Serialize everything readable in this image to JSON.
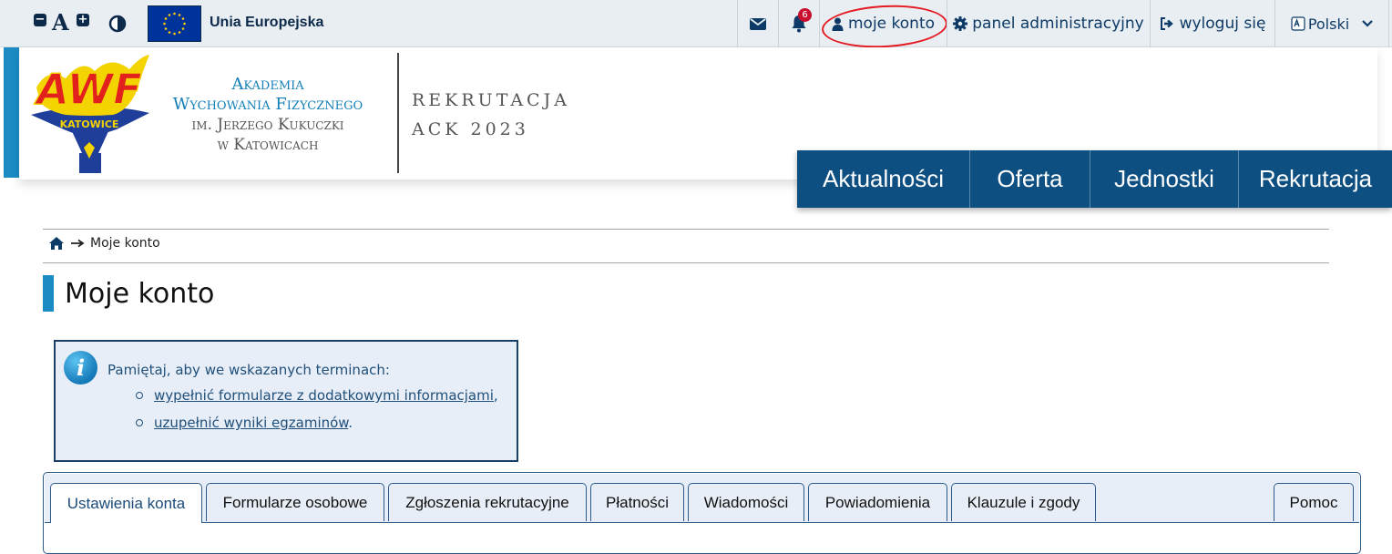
{
  "topbar": {
    "a11y": {
      "decrease": "−",
      "font_label": "A",
      "increase": "+"
    },
    "eu_text": "Unia Europejska",
    "notifications_count": "6",
    "account": "moje konto",
    "admin": "panel administracyjny",
    "logout": "wyloguj się",
    "language": "Polski",
    "icons": [
      "font-decrease-icon",
      "font-increase-icon",
      "contrast-icon",
      "eu-flag-icon",
      "envelope-icon",
      "bell-icon",
      "user-icon",
      "gear-icon",
      "logout-icon",
      "translate-icon",
      "chevron-down-icon"
    ]
  },
  "header": {
    "logo_text": "AWF",
    "logo_city": "KATOWICE",
    "academy": [
      "Akademia",
      "Wychowania Fizycznego",
      "im. Jerzego Kukuczki",
      "w Katowicach"
    ],
    "recruitment": [
      "REKRUTACJA",
      "ACK 2023"
    ]
  },
  "nav": [
    "Aktualności",
    "Oferta",
    "Jednostki",
    "Rekrutacja"
  ],
  "breadcrumb": {
    "current": "Moje konto"
  },
  "page_title": "Moje konto",
  "info": {
    "intro": "Pamiętaj, aby we wskazanych terminach:",
    "items": [
      {
        "link": "wypełnić formularze z dodatkowymi informacjami",
        "suffix": ","
      },
      {
        "link": "uzupełnić wyniki egzaminów",
        "suffix": "."
      }
    ]
  },
  "tabs": [
    "Ustawienia konta",
    "Formularze osobowe",
    "Zgłoszenia rekrutacyjne",
    "Płatności",
    "Wiadomości",
    "Powiadomienia",
    "Klauzule i zgody",
    "Pomoc"
  ],
  "active_tab": "Ustawienia konta",
  "colors": {
    "primary": "#0e4f82",
    "accent": "#1b8bc4",
    "annotation": "#e41b23",
    "badge": "#c8102e"
  }
}
